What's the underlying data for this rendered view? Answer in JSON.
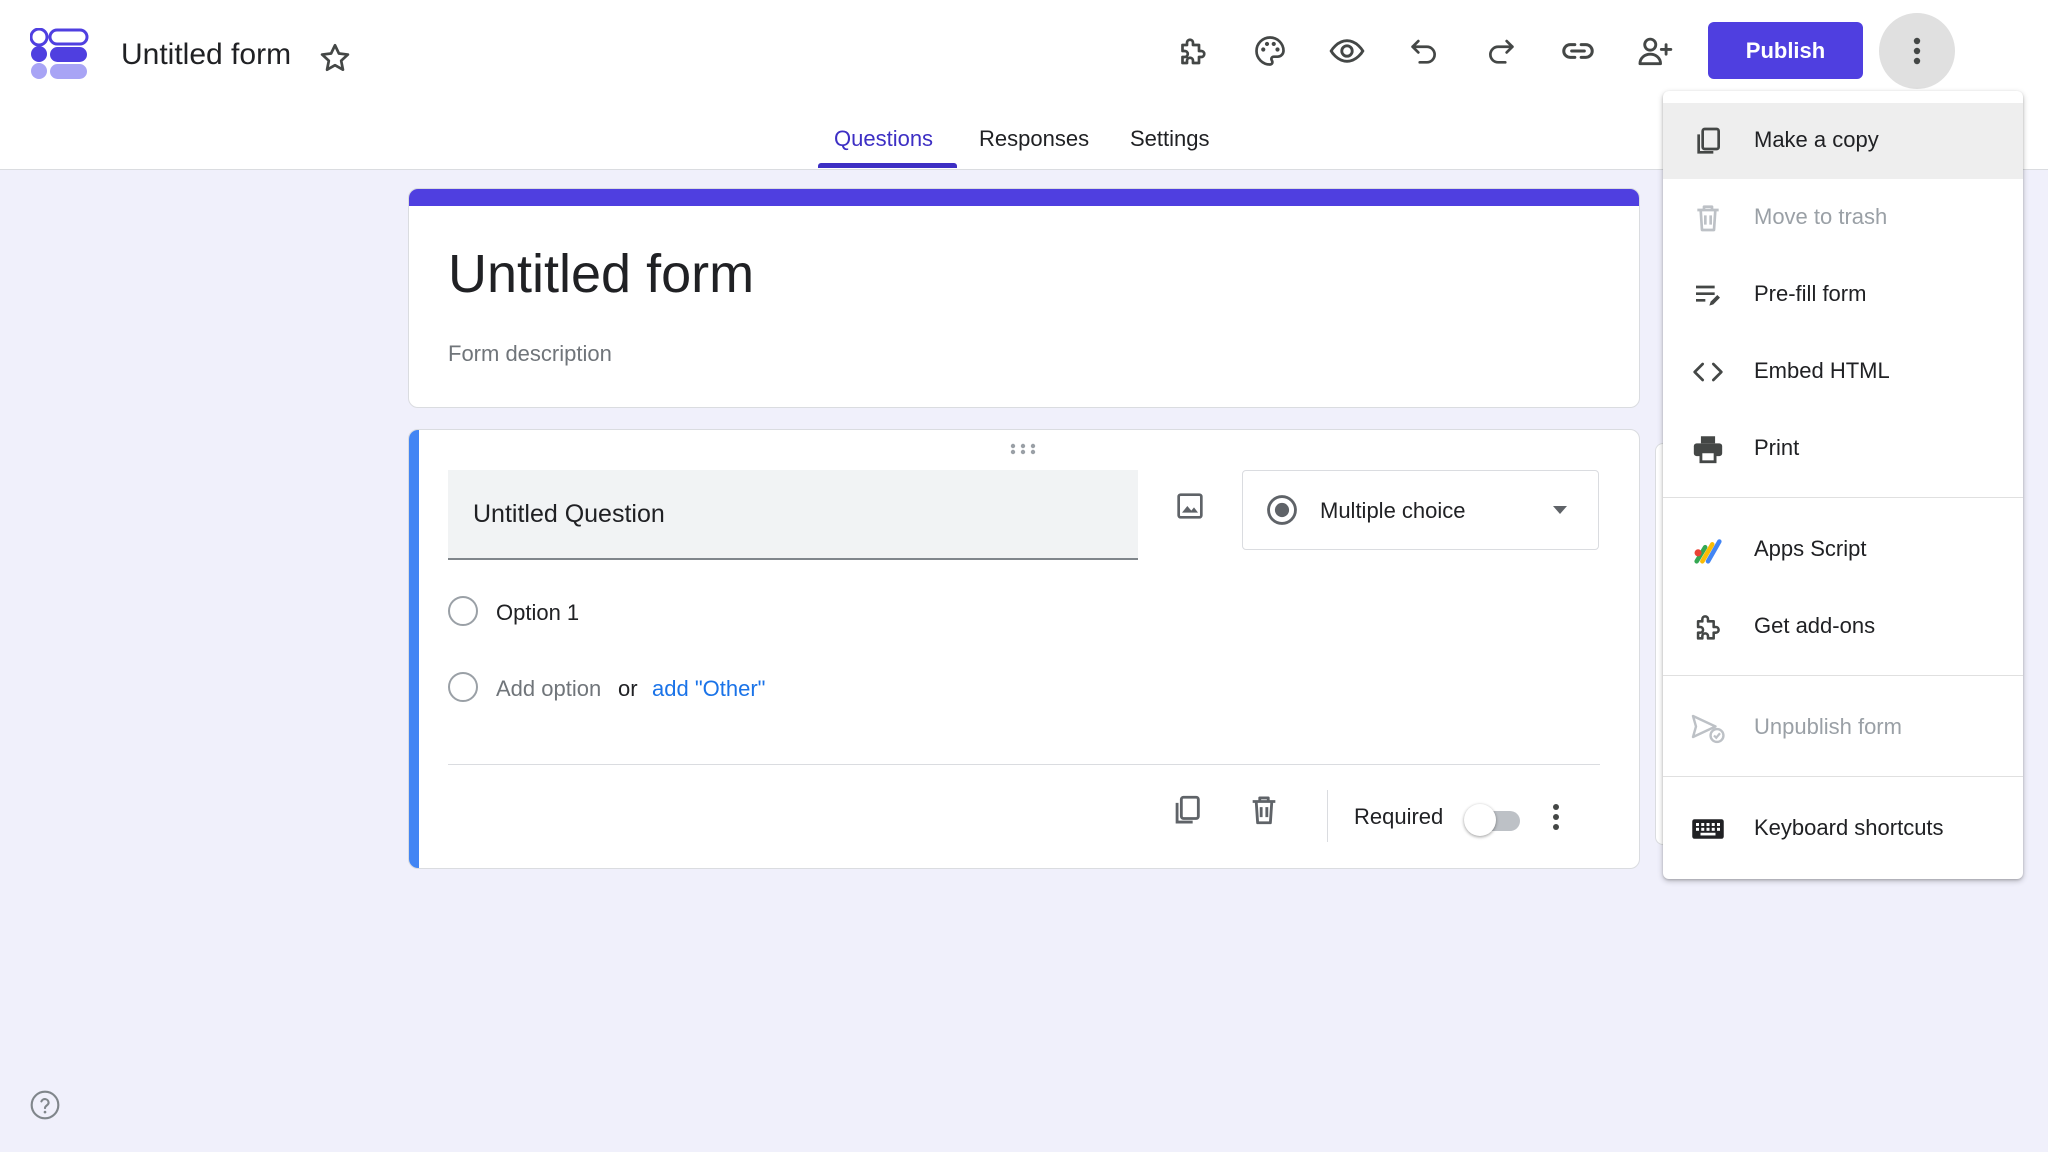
{
  "app": {
    "doc_title": "Untitled form",
    "publish_label": "Publish"
  },
  "tabs": [
    {
      "label": "Questions",
      "active": true
    },
    {
      "label": "Responses",
      "active": false
    },
    {
      "label": "Settings",
      "active": false
    }
  ],
  "toolbar_icons": [
    "addons-puzzle-icon",
    "palette-icon",
    "preview-eye-icon",
    "undo-icon",
    "redo-icon",
    "link-icon",
    "add-collaborator-icon",
    "more-vert-icon"
  ],
  "form": {
    "title": "Untitled form",
    "description_placeholder": "Form description"
  },
  "question": {
    "title": "Untitled Question",
    "type": "Multiple choice",
    "options": [
      "Option 1"
    ],
    "add_option": "Add option",
    "or_text": "or",
    "add_other": "add \"Other\"",
    "required_label": "Required",
    "required_on": false
  },
  "menu": {
    "items": [
      {
        "label": "Make a copy",
        "icon": "copy-icon",
        "disabled": false,
        "highlighted": true
      },
      {
        "label": "Move to trash",
        "icon": "trash-icon",
        "disabled": true,
        "highlighted": false
      },
      {
        "label": "Pre-fill form",
        "icon": "prefill-icon",
        "disabled": false,
        "highlighted": false
      },
      {
        "label": "Embed HTML",
        "icon": "code-icon",
        "disabled": false,
        "highlighted": false
      },
      {
        "label": "Print",
        "icon": "print-icon",
        "disabled": false,
        "highlighted": false
      },
      {
        "label": "Apps Script",
        "icon": "apps-script-icon",
        "disabled": false,
        "highlighted": false
      },
      {
        "label": "Get add-ons",
        "icon": "addons-icon",
        "disabled": false,
        "highlighted": false
      },
      {
        "label": "Unpublish form",
        "icon": "unpublish-icon",
        "disabled": true,
        "highlighted": false
      },
      {
        "label": "Keyboard shortcuts",
        "icon": "keyboard-icon",
        "disabled": false,
        "highlighted": false
      }
    ]
  },
  "colors": {
    "accent": "#4f3fe0",
    "tab_active": "#3d2fc4",
    "question_bar": "#4285f4",
    "page_bg": "#f0f0fb",
    "link": "#1a73e8"
  }
}
